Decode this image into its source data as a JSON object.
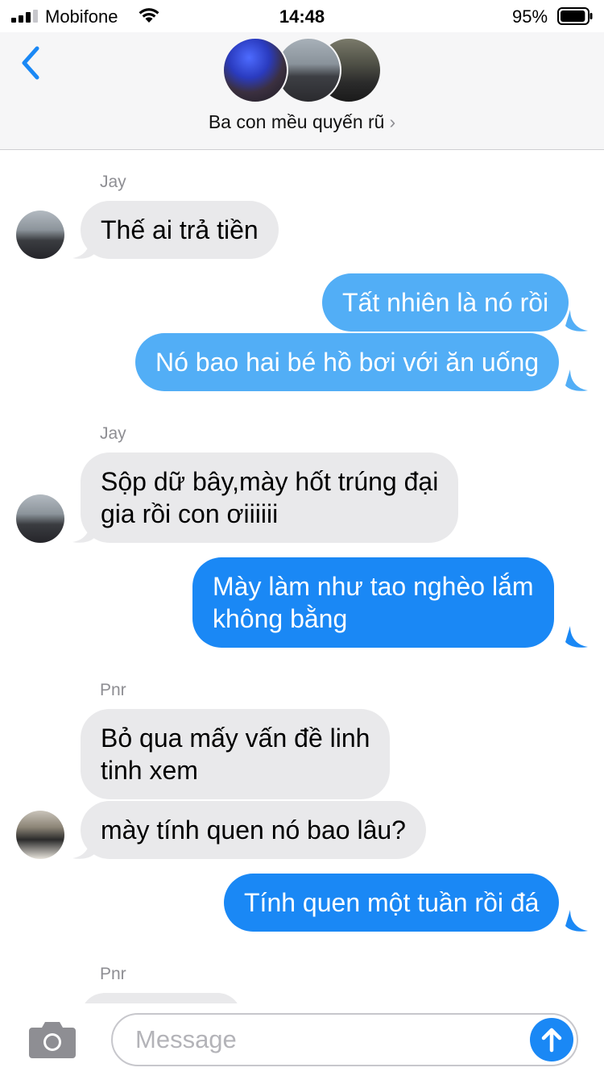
{
  "status_bar": {
    "carrier": "Mobifone",
    "time": "14:48",
    "battery_percent": "95%",
    "battery_level": 0.95,
    "signal_bars": 3,
    "icons": [
      "signal-icon",
      "wifi-icon",
      "battery-icon"
    ]
  },
  "header": {
    "back_icon": "chevron-left-icon",
    "group_name": "Ba con mều quyến rũ",
    "group_chevron": "›"
  },
  "messages": {
    "sender_1": "Jay",
    "m1": "Thế ai trả tiền",
    "m2": "Tất nhiên là nó rồi",
    "m3": "Nó bao hai bé hồ bơi với ăn uống",
    "sender_2": "Jay",
    "m4_line1": "Sộp dữ bây,mày hốt trúng đại",
    "m4_line2": "gia rồi con ơiiiiii",
    "m5_line1": "Mày làm như tao nghèo lắm",
    "m5_line2": "không bằng",
    "sender_3": "Pnr",
    "m6_line1": "Bỏ qua mấy vấn đề linh",
    "m6_line2": "tinh xem",
    "m7": "mày tính quen nó bao lâu?",
    "m8": "Tính quen một tuần rồi đá",
    "sender_4": "Pnr"
  },
  "input": {
    "placeholder": "Message",
    "camera_icon": "camera-icon",
    "send_icon": "arrow-up-icon"
  },
  "colors": {
    "incoming_bubble": "#e9e9eb",
    "outgoing_bubble_light": "#52aef6",
    "outgoing_bubble_blue": "#1a88f5",
    "accent": "#1a88f5",
    "sender_name": "#8e8e93"
  }
}
